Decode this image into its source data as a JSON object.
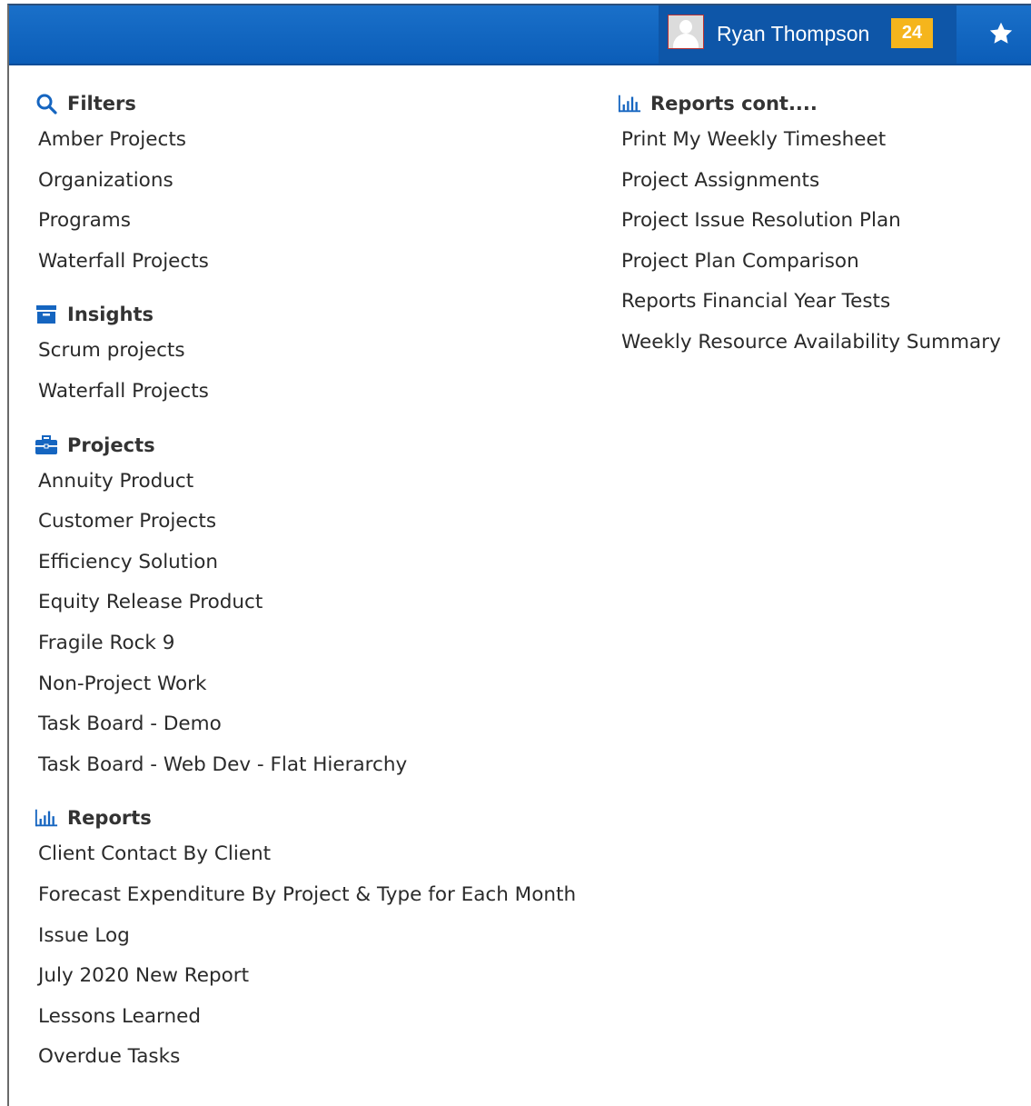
{
  "header": {
    "user_name": "Ryan Thompson",
    "notification_count": "24",
    "accent": "#0e63bd",
    "badge_color": "#f5b51c"
  },
  "sections_left": [
    {
      "icon": "search-icon",
      "title": "Filters",
      "items": [
        "Amber Projects",
        "Organizations",
        "Programs",
        "Waterfall Projects"
      ]
    },
    {
      "icon": "archive-icon",
      "title": "Insights",
      "items": [
        "Scrum projects",
        "Waterfall Projects"
      ]
    },
    {
      "icon": "briefcase-icon",
      "title": "Projects",
      "items": [
        "Annuity Product",
        "Customer Projects",
        "Efficiency Solution",
        "Equity Release Product",
        "Fragile Rock 9",
        "Non-Project Work",
        "Task Board - Demo",
        "Task Board - Web Dev - Flat Hierarchy"
      ]
    },
    {
      "icon": "bar-chart-icon",
      "title": "Reports",
      "items": [
        "Client Contact By Client",
        "Forecast Expenditure By Project & Type for Each Month",
        "Issue Log",
        "July 2020 New Report",
        "Lessons Learned",
        "Overdue Tasks"
      ]
    }
  ],
  "sections_right": [
    {
      "icon": "bar-chart-icon",
      "title": "Reports cont....",
      "items": [
        "Print My Weekly Timesheet",
        "Project Assignments",
        "Project Issue Resolution Plan",
        "Project Plan Comparison",
        "Reports Financial Year Tests",
        "Weekly Resource Availability Summary"
      ]
    }
  ]
}
